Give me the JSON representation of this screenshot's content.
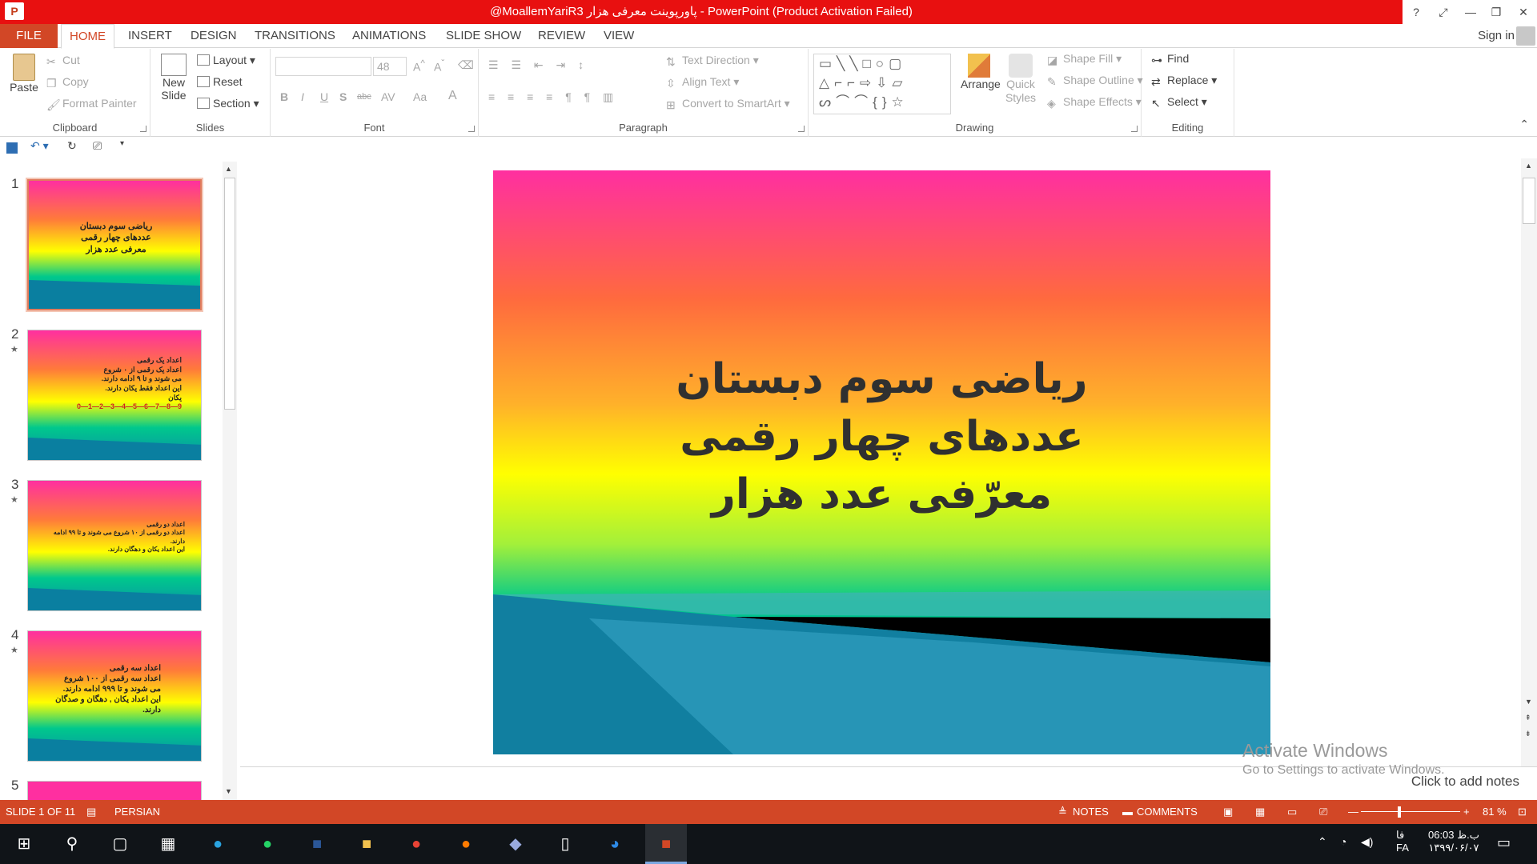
{
  "window": {
    "app_icon_label": "P",
    "title": "@MoallemYariR3 پاورپوینت معرفی هزار - PowerPoint (Product Activation Failed)",
    "controls": [
      "?",
      "⤢",
      "—",
      "❐",
      "✕"
    ]
  },
  "tabs": [
    "FILE",
    "HOME",
    "INSERT",
    "DESIGN",
    "TRANSITIONS",
    "ANIMATIONS",
    "SLIDE SHOW",
    "REVIEW",
    "VIEW"
  ],
  "account": {
    "signin": "Sign in"
  },
  "ribbon": {
    "clipboard": {
      "label": "Clipboard",
      "paste": "Paste",
      "cut": "Cut",
      "copy": "Copy",
      "format_painter": "Format Painter"
    },
    "slides": {
      "label": "Slides",
      "new_slide": "New Slide",
      "layout": "Layout",
      "reset": "Reset",
      "section": "Section"
    },
    "font": {
      "label": "Font",
      "size": "48",
      "buttons": [
        "B",
        "I",
        "U",
        "S",
        "abc",
        "AV",
        "Aa",
        "A"
      ]
    },
    "paragraph": {
      "label": "Paragraph",
      "text_direction": "Text Direction",
      "align_text": "Align Text",
      "convert_smartart": "Convert to SmartArt"
    },
    "drawing": {
      "label": "Drawing",
      "arrange": "Arrange",
      "quick_styles": "Quick Styles",
      "shape_fill": "Shape Fill",
      "shape_outline": "Shape Outline",
      "shape_effects": "Shape Effects"
    },
    "editing": {
      "label": "Editing",
      "find": "Find",
      "replace": "Replace",
      "select": "Select"
    }
  },
  "thumbnails": [
    {
      "num": "1",
      "lines": [
        "ریاضی سوم دبستان",
        "عددهای چهار رقمی",
        "معرفی عدد هزار"
      ]
    },
    {
      "num": "2",
      "lines": [
        "اعداد یک رقمی",
        "اعداد یک رقمی از ۰ شروع",
        "می شوند و تا ۹ ادامه دارند.",
        "این اعداد فقط یکان دارند.",
        "یکان",
        "0—1—2—3—4—5—6—7—8—9"
      ]
    },
    {
      "num": "3",
      "lines": [
        "اعداد دو رقمی",
        "اعداد دو رقمی از ۱۰ شروع می شوند و تا ۹۹ ادامه",
        "دارند.",
        "این اعداد یکان و دهگان دارند."
      ]
    },
    {
      "num": "4",
      "lines": [
        "اعداد سه رقمی",
        "اعداد سه رقمی از ۱۰۰ شروع",
        "می شوند و تا ۹۹۹ ادامه دارند.",
        "این اعداد یکان , دهگان و صدگان",
        "دارند."
      ]
    },
    {
      "num": "5",
      "lines": []
    }
  ],
  "slide": {
    "title_lines": [
      "ریاضی سوم دبستان",
      "عددهای چهار رقمی",
      "معرّفی عدد هزار"
    ]
  },
  "notes": {
    "placeholder": "Click to add notes"
  },
  "watermark": {
    "line1": "Activate Windows",
    "line2": "Go to Settings to activate Windows."
  },
  "statusbar": {
    "slide_info": "SLIDE 1 OF 11",
    "language": "PERSIAN",
    "notes": "NOTES",
    "comments": "COMMENTS",
    "zoom": "81 %"
  },
  "taskbar": {
    "time": "06:03 ب.ظ",
    "date": "۱۳۹۹/۰۶/۰۷",
    "lang": "فا",
    "lang2": "FA"
  },
  "colors": {
    "accent": "#d24726",
    "titlebar": "#e81010"
  }
}
